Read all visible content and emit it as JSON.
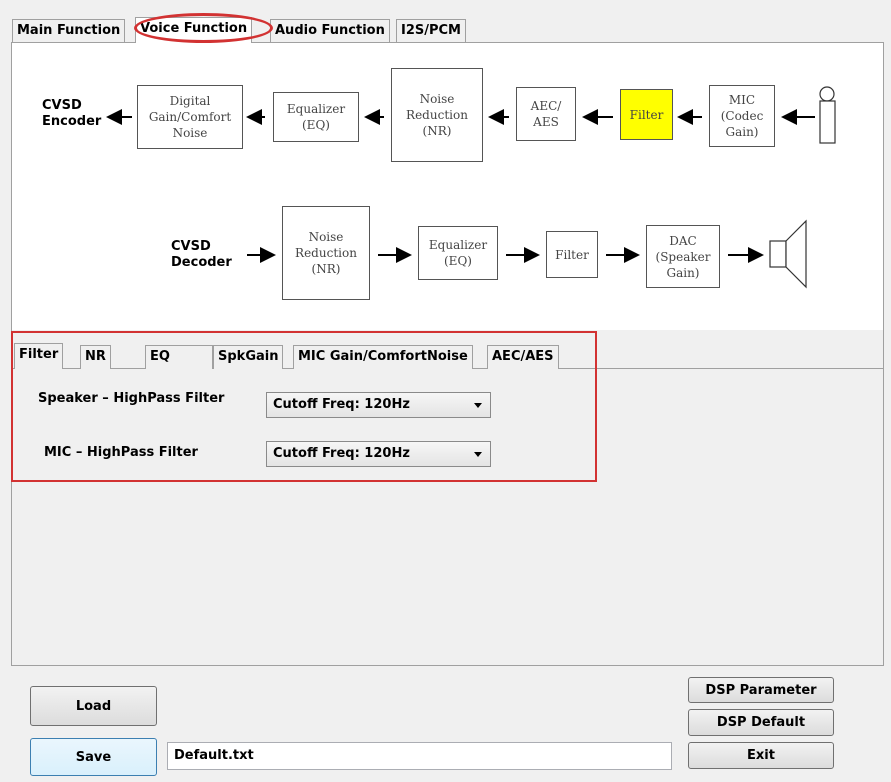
{
  "top_tabs": [
    "Main Function",
    "Voice Function",
    "Audio Function",
    "I2S/PCM"
  ],
  "encoder_chain": {
    "label": "CVSD\nEncoder",
    "blocks": [
      "Digital\nGain/Comfort\nNoise",
      "Equalizer\n(EQ)",
      "Noise\nReduction\n(NR)",
      "AEC/\nAES",
      "Filter",
      "MIC\n(Codec\nGain)"
    ]
  },
  "decoder_chain": {
    "label": "CVSD\nDecoder",
    "blocks": [
      "Noise\nReduction\n(NR)",
      "Equalizer\n(EQ)",
      "Filter",
      "DAC\n(Speaker\nGain)"
    ]
  },
  "sub_tabs": [
    "Filter",
    "NR",
    "EQ",
    "SpkGain",
    "MIC Gain/ComfortNoise",
    "AEC/AES"
  ],
  "filter_settings": {
    "speaker_label": "Speaker – HighPass Filter",
    "speaker_value": "Cutoff Freq: 120Hz",
    "mic_label": "MIC – HighPass Filter",
    "mic_value": "Cutoff Freq: 120Hz"
  },
  "buttons": {
    "load": "Load",
    "save": "Save",
    "dsp_parameter": "DSP Parameter",
    "dsp_default": "DSP Default",
    "exit": "Exit"
  },
  "file_name": "Default.txt",
  "colors": {
    "highlight": "#ffff00",
    "annotation": "#d23232"
  },
  "icons": [
    "microphone-icon",
    "speaker-icon"
  ]
}
